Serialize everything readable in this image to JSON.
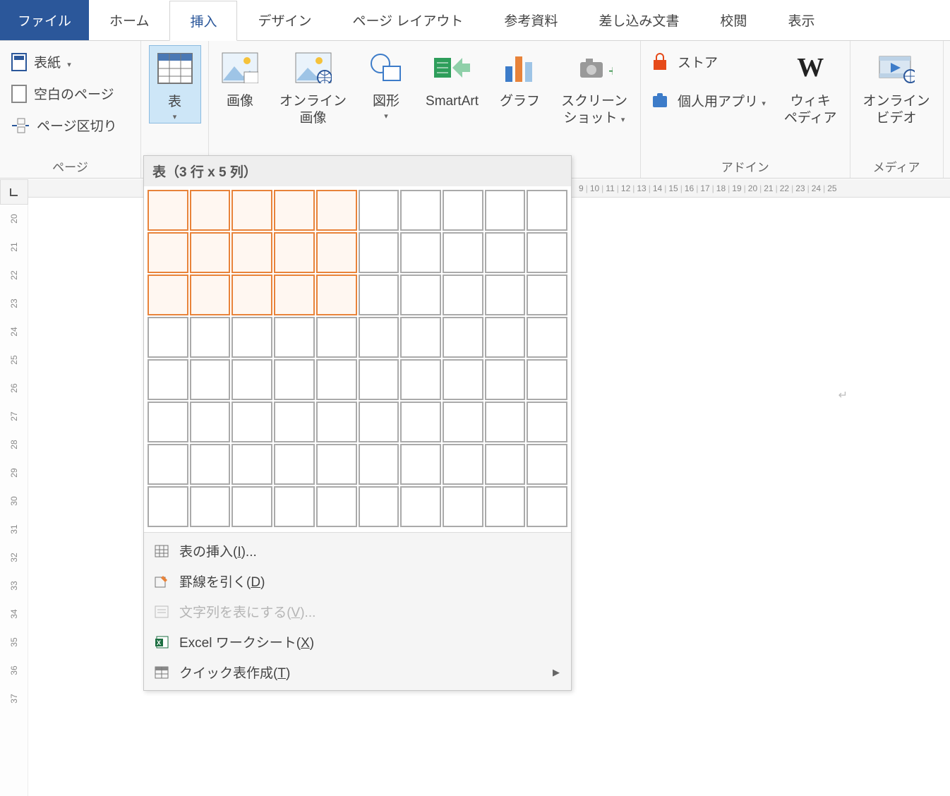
{
  "tabs": {
    "file": "ファイル",
    "home": "ホーム",
    "insert": "挿入",
    "design": "デザイン",
    "layout": "ページ レイアウト",
    "references": "参考資料",
    "mailings": "差し込み文書",
    "review": "校閲",
    "view": "表示"
  },
  "groups": {
    "page": {
      "label": "ページ",
      "cover": "表紙",
      "blank": "空白のページ",
      "break": "ページ区切り"
    },
    "table": {
      "label": "表",
      "button": "表"
    },
    "illustrations": {
      "image": "画像",
      "online_image": "オンライン\n画像",
      "shapes": "図形",
      "smartart": "SmartArt",
      "chart": "グラフ",
      "screenshot": "スクリーン\nショット"
    },
    "addins": {
      "label": "アドイン",
      "store": "ストア",
      "myapps": "個人用アプリ",
      "wikipedia": "ウィキ\nペディア"
    },
    "media": {
      "label": "メディア",
      "online_video": "オンライン\nビデオ"
    }
  },
  "table_dropdown": {
    "header": "表（3 行 x 5 列）",
    "rows": 8,
    "cols": 10,
    "sel_rows": 3,
    "sel_cols": 5,
    "menu": {
      "insert_table_pre": "表の挿入(",
      "insert_table_key": "I",
      "insert_table_post": ")...",
      "draw_table_pre": "罫線を引く(",
      "draw_table_key": "D",
      "draw_table_post": ")",
      "convert_text_pre": "文字列を表にする(",
      "convert_text_key": "V",
      "convert_text_post": ")...",
      "excel_pre": "Excel ワークシート(",
      "excel_key": "X",
      "excel_post": ")",
      "quick_pre": "クイック表作成(",
      "quick_key": "T",
      "quick_post": ")"
    }
  },
  "h_ruler": [
    "9",
    "10",
    "11",
    "12",
    "13",
    "14",
    "15",
    "16",
    "17",
    "18",
    "19",
    "20",
    "21",
    "22",
    "23",
    "24",
    "25"
  ],
  "v_ruler": [
    "20",
    "21",
    "22",
    "23",
    "24",
    "25",
    "26",
    "27",
    "28",
    "29",
    "30",
    "31",
    "32",
    "33",
    "34",
    "35",
    "36",
    "37"
  ]
}
